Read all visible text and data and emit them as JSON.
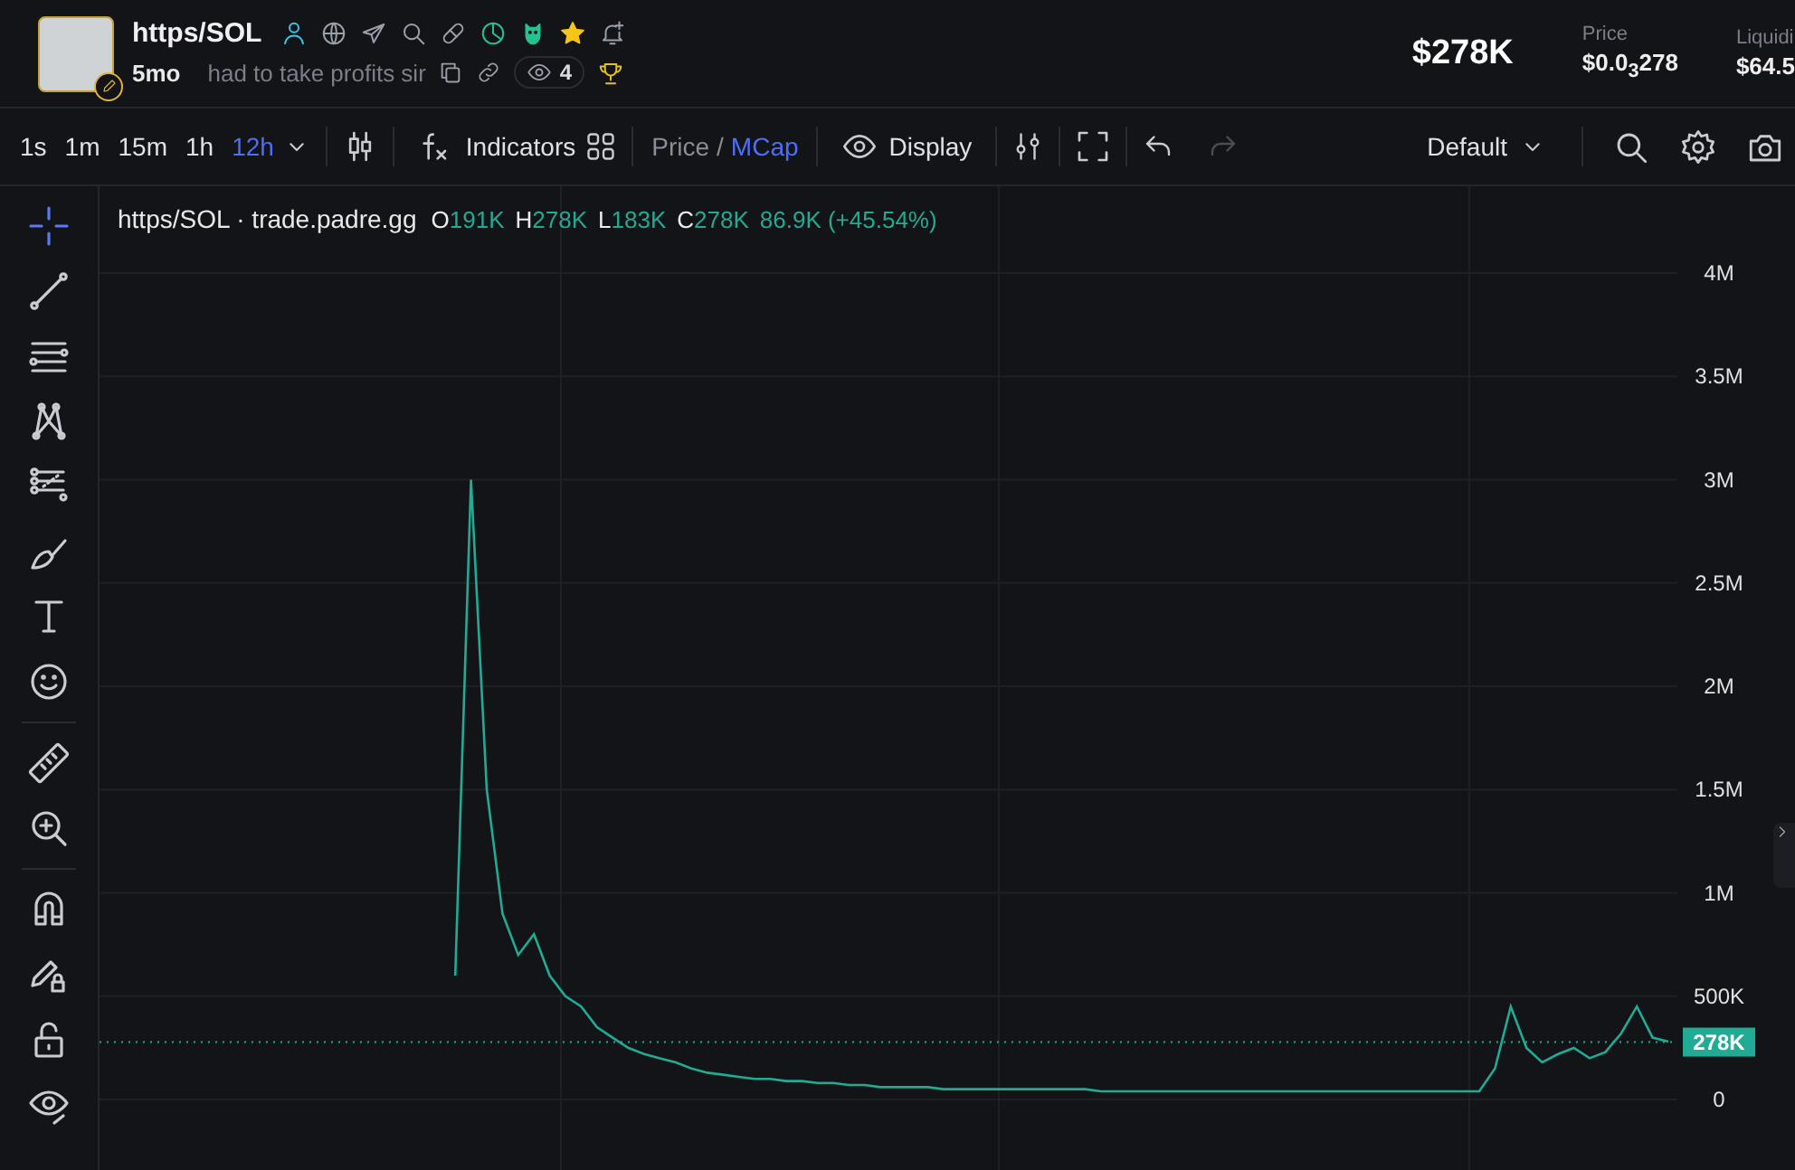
{
  "header": {
    "token_name": "https/SOL",
    "age": "5mo",
    "description": "had to take profits sir",
    "watchers": "4",
    "market_cap": "$278K",
    "stats": [
      {
        "label": "Price",
        "value": "$0.0$_{3}$278"
      },
      {
        "label": "Liquidi",
        "value": "$64.5"
      }
    ]
  },
  "toolbar": {
    "intervals": [
      {
        "label": "1s",
        "selected": false
      },
      {
        "label": "1m",
        "selected": false
      },
      {
        "label": "15m",
        "selected": false
      },
      {
        "label": "1h",
        "selected": false
      },
      {
        "label": "12h",
        "selected": true
      }
    ],
    "indicators": "Indicators",
    "scale_modes": [
      {
        "label": "Price",
        "selected": false
      },
      {
        "label": "MCap",
        "selected": true
      }
    ],
    "scale_separator": "/",
    "display": "Display",
    "redo": {
      "disabled": true
    },
    "layout": "Default"
  },
  "sidebar": {
    "tools": [
      {
        "kind": "crosshair",
        "selected": true
      },
      {
        "kind": "line",
        "selected": false
      },
      {
        "kind": "hlines",
        "selected": false
      },
      {
        "kind": "pattern",
        "selected": false
      },
      {
        "kind": "fib",
        "selected": false
      },
      {
        "kind": "brush",
        "selected": false
      },
      {
        "kind": "text",
        "selected": false
      },
      {
        "kind": "emoji",
        "selected": false
      },
      {
        "kind": "ruler",
        "selected": false
      },
      {
        "kind": "zoom",
        "selected": false
      },
      {
        "kind": "magnet",
        "selected": false
      },
      {
        "kind": "lockdraw",
        "selected": false
      },
      {
        "kind": "lock",
        "selected": false
      },
      {
        "kind": "hide",
        "selected": false
      }
    ]
  },
  "chart": {
    "legend": {
      "symbol": "https/SOL · trade.padre.gg",
      "ohlc": [
        {
          "key": "O",
          "value": "191K"
        },
        {
          "key": "H",
          "value": "278K"
        },
        {
          "key": "L",
          "value": "183K"
        },
        {
          "key": "C",
          "value": "278K"
        }
      ],
      "change": "86.9K (+45.54%)"
    },
    "chart_data": {
      "type": "line",
      "ylim": [
        -341000,
        4420000
      ],
      "yticks": [
        {
          "value": 0,
          "label": "0"
        },
        {
          "value": 500000,
          "label": "500K"
        },
        {
          "value": 1000000,
          "label": "1M"
        },
        {
          "value": 1500000,
          "label": "1.5M"
        },
        {
          "value": 2000000,
          "label": "2M"
        },
        {
          "value": 2500000,
          "label": "2.5M"
        },
        {
          "value": 3000000,
          "label": "3M"
        },
        {
          "value": 3500000,
          "label": "3.5M"
        },
        {
          "value": 4000000,
          "label": "4M"
        }
      ],
      "series": [
        {
          "color": "#22ab94",
          "values": [
            null,
            null,
            null,
            null,
            null,
            null,
            null,
            null,
            null,
            null,
            null,
            null,
            null,
            null,
            null,
            null,
            null,
            null,
            null,
            null,
            null,
            null,
            600000,
            3000000,
            1500000,
            900000,
            700000,
            800000,
            600000,
            500000,
            450000,
            350000,
            300000,
            250000,
            220000,
            200000,
            180000,
            150000,
            130000,
            120000,
            110000,
            100000,
            100000,
            90000,
            90000,
            80000,
            80000,
            70000,
            70000,
            60000,
            60000,
            60000,
            60000,
            50000,
            50000,
            50000,
            50000,
            50000,
            50000,
            50000,
            50000,
            50000,
            50000,
            40000,
            40000,
            40000,
            40000,
            40000,
            40000,
            40000,
            40000,
            40000,
            40000,
            40000,
            40000,
            40000,
            40000,
            40000,
            40000,
            40000,
            40000,
            40000,
            40000,
            40000,
            40000,
            40000,
            40000,
            40000,
            150000,
            450000,
            250000,
            180000,
            220000,
            250000,
            200000,
            230000,
            320000,
            450000,
            300000,
            280000
          ]
        }
      ],
      "ref_lines": [
        {
          "axis": "y",
          "value": 278000,
          "label": "278K",
          "color": "#22ab94"
        }
      ],
      "grid": true
    }
  }
}
